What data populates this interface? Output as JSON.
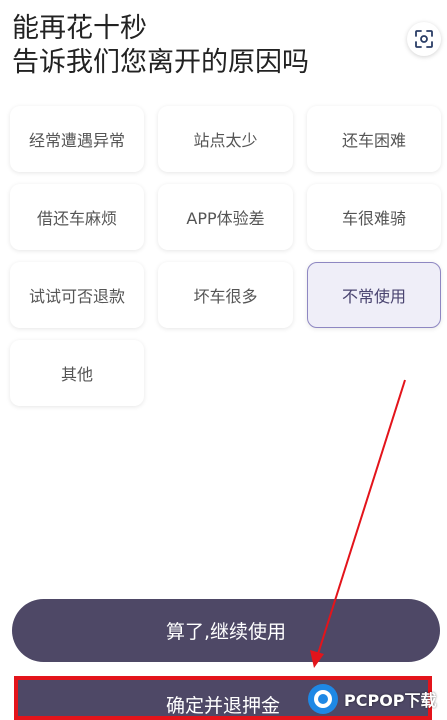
{
  "header": {
    "title_line1": "能再花十秒",
    "title_line2": "告诉我们您离开的原因吗",
    "scan_icon": "scan-icon"
  },
  "reasons": [
    {
      "label": "经常遭遇异常",
      "selected": false
    },
    {
      "label": "站点太少",
      "selected": false
    },
    {
      "label": "还车困难",
      "selected": false
    },
    {
      "label": "借还车麻烦",
      "selected": false
    },
    {
      "label": "APP体验差",
      "selected": false
    },
    {
      "label": "车很难骑",
      "selected": false
    },
    {
      "label": "试试可否退款",
      "selected": false
    },
    {
      "label": "坏车很多",
      "selected": false
    },
    {
      "label": "不常使用",
      "selected": true
    },
    {
      "label": "其他",
      "selected": false
    }
  ],
  "buttons": {
    "continue_label": "算了,继续使用",
    "confirm_label": "确定并退押金"
  },
  "watermark": {
    "logo": "PCPOP下载"
  },
  "colors": {
    "button_bg": "#4e4866",
    "selected_border": "#8e87c2",
    "annotation_red": "#e3141b"
  }
}
